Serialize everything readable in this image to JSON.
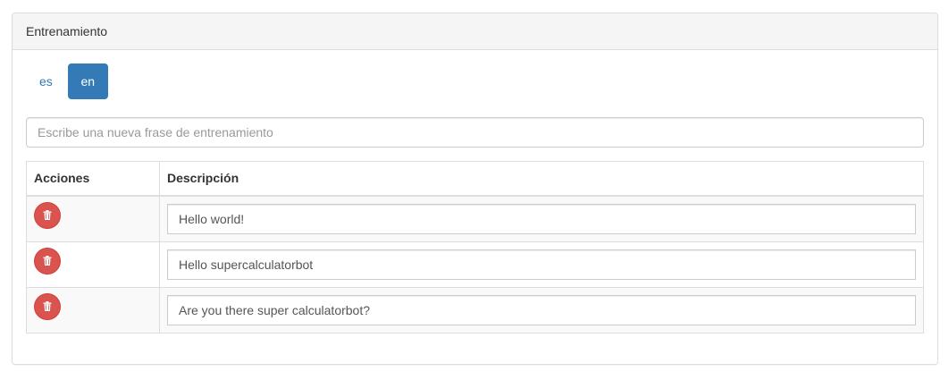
{
  "panel": {
    "title": "Entrenamiento"
  },
  "languages": {
    "items": [
      {
        "label": "es",
        "active": false
      },
      {
        "label": "en",
        "active": true
      }
    ]
  },
  "new_phrase": {
    "placeholder": "Escribe una nueva frase de entrenamiento",
    "value": ""
  },
  "table": {
    "headers": {
      "actions": "Acciones",
      "description": "Descripción"
    },
    "rows": [
      {
        "description": "Hello world!",
        "delete_icon": "trash-icon"
      },
      {
        "description": "Hello supercalculatorbot",
        "delete_icon": "trash-icon"
      },
      {
        "description": "Are you there super calculatorbot?",
        "delete_icon": "trash-icon"
      }
    ]
  },
  "colors": {
    "primary": "#337ab7",
    "danger": "#d9534f",
    "panel_heading_bg": "#f5f5f5",
    "stripe_bg": "#f9f9f9"
  }
}
